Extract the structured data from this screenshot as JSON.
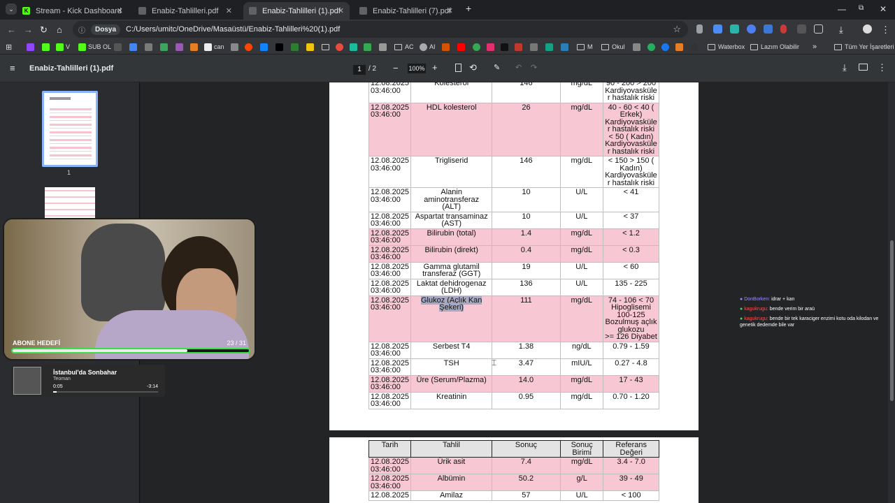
{
  "tabs": [
    {
      "title": "Stream - Kick Dashboard",
      "color": "#53fc18",
      "letter": "K",
      "active": false
    },
    {
      "title": "Enabiz-Tahlilleri.pdf",
      "color": "#5f6368",
      "letter": "",
      "active": false
    },
    {
      "title": "Enabiz-Tahlilleri (1).pdf",
      "color": "#5f6368",
      "letter": "",
      "active": true
    },
    {
      "title": "Enabiz-Tahlilleri (7).pdf",
      "color": "#5f6368",
      "letter": "",
      "active": false
    }
  ],
  "address": {
    "chip": "Dosya",
    "url": "C:/Users/umitc/OneDrive/Masaüstü/Enabiz-Tahlilleri%20(1).pdf"
  },
  "bookmarks": {
    "items": [
      "K V",
      "SUB OL",
      "can",
      "AC",
      "AI",
      "M",
      "Okul",
      "Waterbox",
      "Lazım Olabilir"
    ],
    "more": "»",
    "all": "Tüm Yer İşaretleri"
  },
  "pdf": {
    "filename": "Enabiz-Tahlilleri (1).pdf",
    "page_current": "1",
    "page_total": "/ 2",
    "zoom": "100%",
    "thumb_label_1": "1"
  },
  "table1_rows": [
    {
      "date": "12.08.2025\n03:46:00",
      "test": "Kolesterol",
      "result": "146",
      "unit": "mg/dL",
      "ref": "90 - 200  > 200\nKardiyovaskülе\nr hastalık riski",
      "pink": false
    },
    {
      "date": "12.08.2025\n03:46:00",
      "test": "HDL kolesterol",
      "result": "26",
      "unit": "mg/dL",
      "ref": "40 - 60  < 40  (\nErkek)\nKardiyovaskülе\nr hastalık riski\n< 50  ( Kadın)\nKardiyovaskülе\nr hastalık riski",
      "pink": true
    },
    {
      "date": "12.08.2025\n03:46:00",
      "test": "Trigliserid",
      "result": "146",
      "unit": "mg/dL",
      "ref": "< 150  > 150  (\nKadın)\nKardiyovaskülе\nr hastalık riski",
      "pink": false
    },
    {
      "date": "12.08.2025\n03:46:00",
      "test": "Alanin aminotransferaz\n(ALT)",
      "result": "10",
      "unit": "U/L",
      "ref": "< 41",
      "pink": false
    },
    {
      "date": "12.08.2025\n03:46:00",
      "test": "Aspartat transaminaz\n(AST)",
      "result": "10",
      "unit": "U/L",
      "ref": "< 37",
      "pink": false
    },
    {
      "date": "12.08.2025\n03:46:00",
      "test": "Bilirubin (total)",
      "result": "1.4",
      "unit": "mg/dL",
      "ref": "< 1.2",
      "pink": true
    },
    {
      "date": "12.08.2025\n03:46:00",
      "test": "Bilirubin (direkt)",
      "result": "0.4",
      "unit": "mg/dL",
      "ref": "< 0.3",
      "pink": true
    },
    {
      "date": "12.08.2025\n03:46:00",
      "test": "Gamma glutamil\ntransferaz (GGT)",
      "result": "19",
      "unit": "U/L",
      "ref": "< 60",
      "pink": false
    },
    {
      "date": "12.08.2025\n03:46:00",
      "test": "Laktat dehidrogenaz\n(LDH)",
      "result": "136",
      "unit": "U/L",
      "ref": "135 - 225",
      "pink": false
    },
    {
      "date": "12.08.2025\n03:46:00",
      "test": "Glukoz (Açlık Kan\nŞekeri)",
      "result": "111",
      "unit": "mg/dL",
      "ref": "74 - 106 < 70\nHipoglisemi\n100-125\nBozulmuş açlık\nglukozu\n>= 126 Diyabet",
      "pink": true,
      "highlight": true
    },
    {
      "date": "12.08.2025\n03:46:00",
      "test": "Serbest T4",
      "result": "1.38",
      "unit": "ng/dL",
      "ref": "0.79 - 1.59",
      "pink": false
    },
    {
      "date": "12.08.2025\n03:46:00",
      "test": "TSH",
      "result": "3.47",
      "unit": "mIU/L",
      "ref": "0.27 - 4.8",
      "pink": false
    },
    {
      "date": "12.08.2025\n03:46:00",
      "test": "Üre (Serum/Plazma)",
      "result": "14.0",
      "unit": "mg/dL",
      "ref": "17 - 43",
      "pink": true
    },
    {
      "date": "12.08.2025\n03:46:00",
      "test": "Kreatinin",
      "result": "0.95",
      "unit": "mg/dL",
      "ref": "0.70 - 1.20",
      "pink": false
    }
  ],
  "table2_headers": [
    "Tarih",
    "Tahlil",
    "Sonuç",
    "Sonuç\nBirimi",
    "Referans\nDeğeri"
  ],
  "table2_rows": [
    {
      "date": "12.08.2025\n03:46:00",
      "test": "Ürik asit",
      "result": "7.4",
      "unit": "mg/dL",
      "ref": "3.4 - 7.0",
      "pink": true
    },
    {
      "date": "12.08.2025\n03:46:00",
      "test": "Albümin",
      "result": "50.2",
      "unit": "g/L",
      "ref": "39 - 49",
      "pink": true
    },
    {
      "date": "12.08.2025",
      "test": "Amilaz",
      "result": "57",
      "unit": "U/L",
      "ref": "< 100",
      "pink": false
    }
  ],
  "overlay": {
    "sub_goal_label": "ABONE HEDEFİ",
    "sub_goal_count": "23 / 31",
    "sub_goal_progress": 0.74,
    "song_title": "İstanbul'da Sonbahar",
    "song_artist": "Teoman",
    "song_elapsed": "0:05",
    "song_remaining": "-3:14"
  },
  "chat": [
    {
      "user": "DonBorken:",
      "text": "idrar + kan",
      "color": "#9a8cff"
    },
    {
      "user": "kagukrugu:",
      "text": "bende verim bir araü",
      "color": "#ff4e4e"
    },
    {
      "user": "kagukrugu:",
      "text": "bende bir tek karaciger enzimi kotu oda kilodan ve genetik dedemde bile var",
      "color": "#ff4e4e"
    }
  ]
}
